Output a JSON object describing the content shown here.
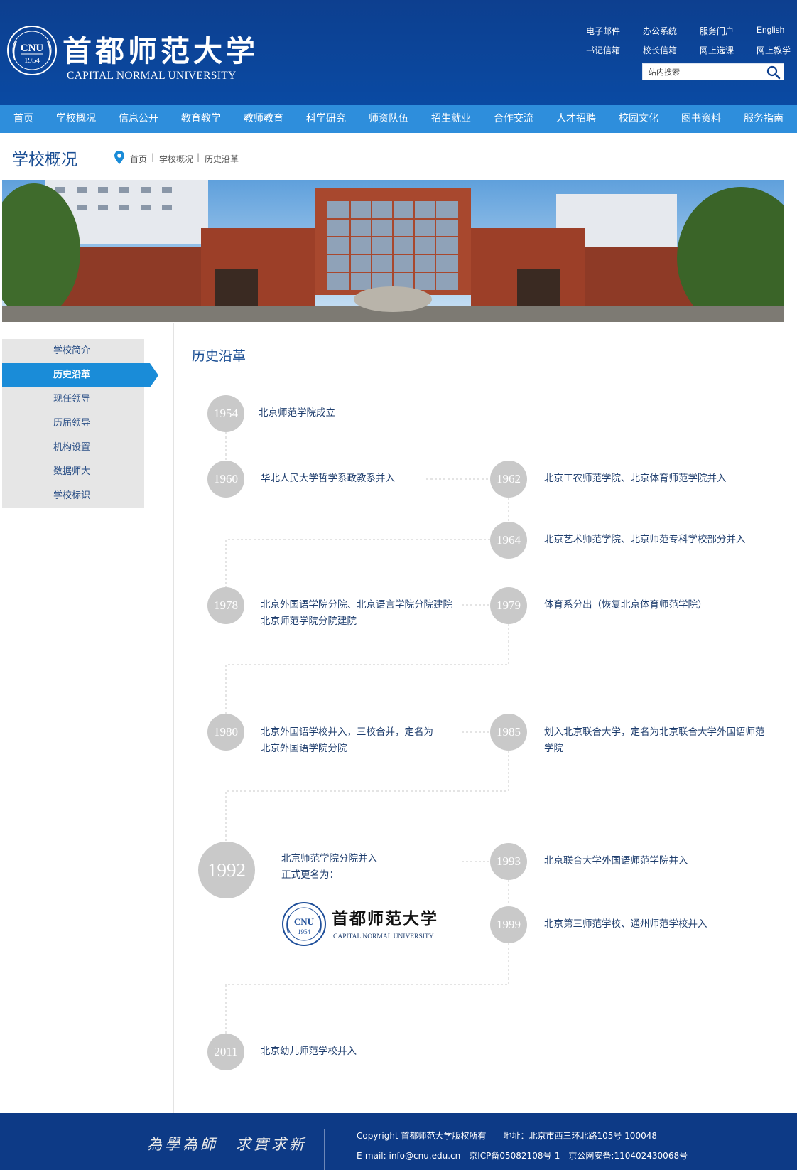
{
  "header": {
    "logo_cn": "首都师范大学",
    "logo_en": "CAPITAL NORMAL UNIVERSITY",
    "seal_text": "CNU",
    "seal_year": "1954",
    "seal_ring": "CAPITAL NORMAL UNIVERSITY",
    "top_links": [
      "电子邮件",
      "办公系统",
      "服务门户",
      "English",
      "书记信箱",
      "校长信箱",
      "网上选课",
      "网上教学"
    ],
    "search_placeholder": "站内搜索"
  },
  "nav": {
    "items": [
      "首页",
      "学校概况",
      "信息公开",
      "教育教学",
      "教师教育",
      "科学研究",
      "师资队伍",
      "招生就业",
      "合作交流",
      "人才招聘",
      "校园文化",
      "图书资料",
      "服务指南"
    ]
  },
  "section": {
    "title": "学校概况",
    "breadcrumb": [
      "首页",
      "学校概况",
      "历史沿革"
    ],
    "breadcrumb_sep": "|"
  },
  "sidebar": {
    "items": [
      "学校简介",
      "历史沿革",
      "现任领导",
      "历届领导",
      "机构设置",
      "数据师大",
      "学校标识"
    ],
    "active_index": 1
  },
  "content": {
    "title": "历史沿革",
    "timeline": [
      {
        "year": "1954",
        "lines": [
          "北京师范学院成立"
        ]
      },
      {
        "year": "1960",
        "lines": [
          "华北人民大学哲学系政教系并入"
        ]
      },
      {
        "year": "1962",
        "lines": [
          "北京工农师范学院、北京体育师范学院并入"
        ]
      },
      {
        "year": "1964",
        "lines": [
          "北京艺术师范学院、北京师范专科学校部分并入"
        ]
      },
      {
        "year": "1978",
        "lines": [
          "北京外国语学院分院、北京语言学院分院建院",
          "北京师范学院分院建院"
        ]
      },
      {
        "year": "1979",
        "lines": [
          "体育系分出（恢复北京体育师范学院）"
        ]
      },
      {
        "year": "1980",
        "lines": [
          "北京外国语学校并入，三校合并，定名为",
          "北京外国语学院分院"
        ]
      },
      {
        "year": "1985",
        "lines": [
          "划入北京联合大学，定名为北京联合大学外国语师范",
          "学院"
        ]
      },
      {
        "year": "1992",
        "lines": [
          "北京师范学院分院并入",
          "正式更名为："
        ]
      },
      {
        "year": "1993",
        "lines": [
          "北京联合大学外国语师范学院并入"
        ]
      },
      {
        "year": "1999",
        "lines": [
          "北京第三师范学校、通州师范学校并入"
        ]
      },
      {
        "year": "2011",
        "lines": [
          "北京幼儿师范学校并入"
        ]
      }
    ],
    "logo_cn": "首都师范大学",
    "logo_en": "CAPITAL NORMAL UNIVERSITY"
  },
  "footer": {
    "motto": "為學為師　求實求新",
    "line1": "Copyright 首都师范大学版权所有　　地址：北京市西三环北路105号 100048",
    "line2": "E-mail: info@cnu.edu.cn　京ICP备05082108号-1　京公网安备:110402430068号"
  },
  "colors": {
    "header_bg": "#0d3f8f",
    "nav_bg": "#2e8edc",
    "active_side": "#1a8cd8",
    "year_circle": "#c9c9c9",
    "title_blue": "#1b4f94",
    "footer_bg": "#0d3a86"
  }
}
